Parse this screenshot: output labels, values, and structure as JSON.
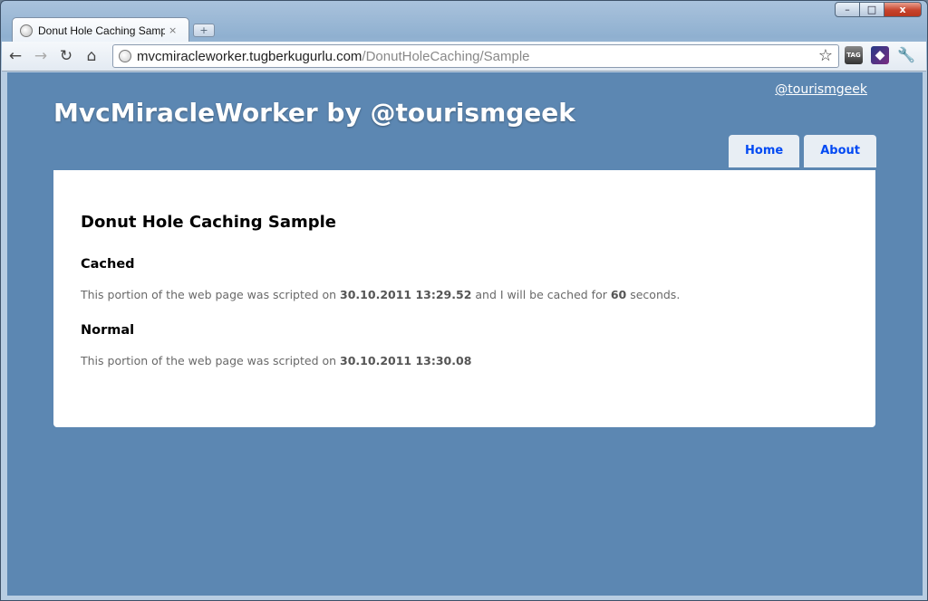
{
  "browser": {
    "tab_title": "Donut Hole Caching Sampl",
    "tab_close": "×",
    "new_tab": "+",
    "back": "←",
    "forward": "→",
    "reload": "↻",
    "home": "⌂",
    "url_host": "mvcmiracleworker.tugberkugurlu.com",
    "url_path": "/DonutHoleCaching/Sample",
    "star": "☆",
    "tag_label": "TAG",
    "wrench": "🔧",
    "window_buttons": {
      "minimize": "–",
      "maximize": "□",
      "close": "x"
    }
  },
  "site": {
    "twitter_link": "@tourismgeek",
    "title": "MvcMiracleWorker by @tourismgeek",
    "menu": [
      {
        "label": "Home"
      },
      {
        "label": "About"
      }
    ]
  },
  "content": {
    "heading": "Donut Hole Caching Sample",
    "cached": {
      "heading": "Cached",
      "text_before": "This portion of the web page was scripted on ",
      "timestamp": "30.10.2011 13:29.52",
      "text_middle": " and I will be cached for ",
      "seconds": "60",
      "text_after": " seconds."
    },
    "normal": {
      "heading": "Normal",
      "text_before": "This portion of the web page was scripted on ",
      "timestamp": "30.10.2011 13:30.08"
    }
  },
  "colors": {
    "page_background": "#5c87b2",
    "menu_link": "#034af3",
    "content_background": "#ffffff"
  }
}
